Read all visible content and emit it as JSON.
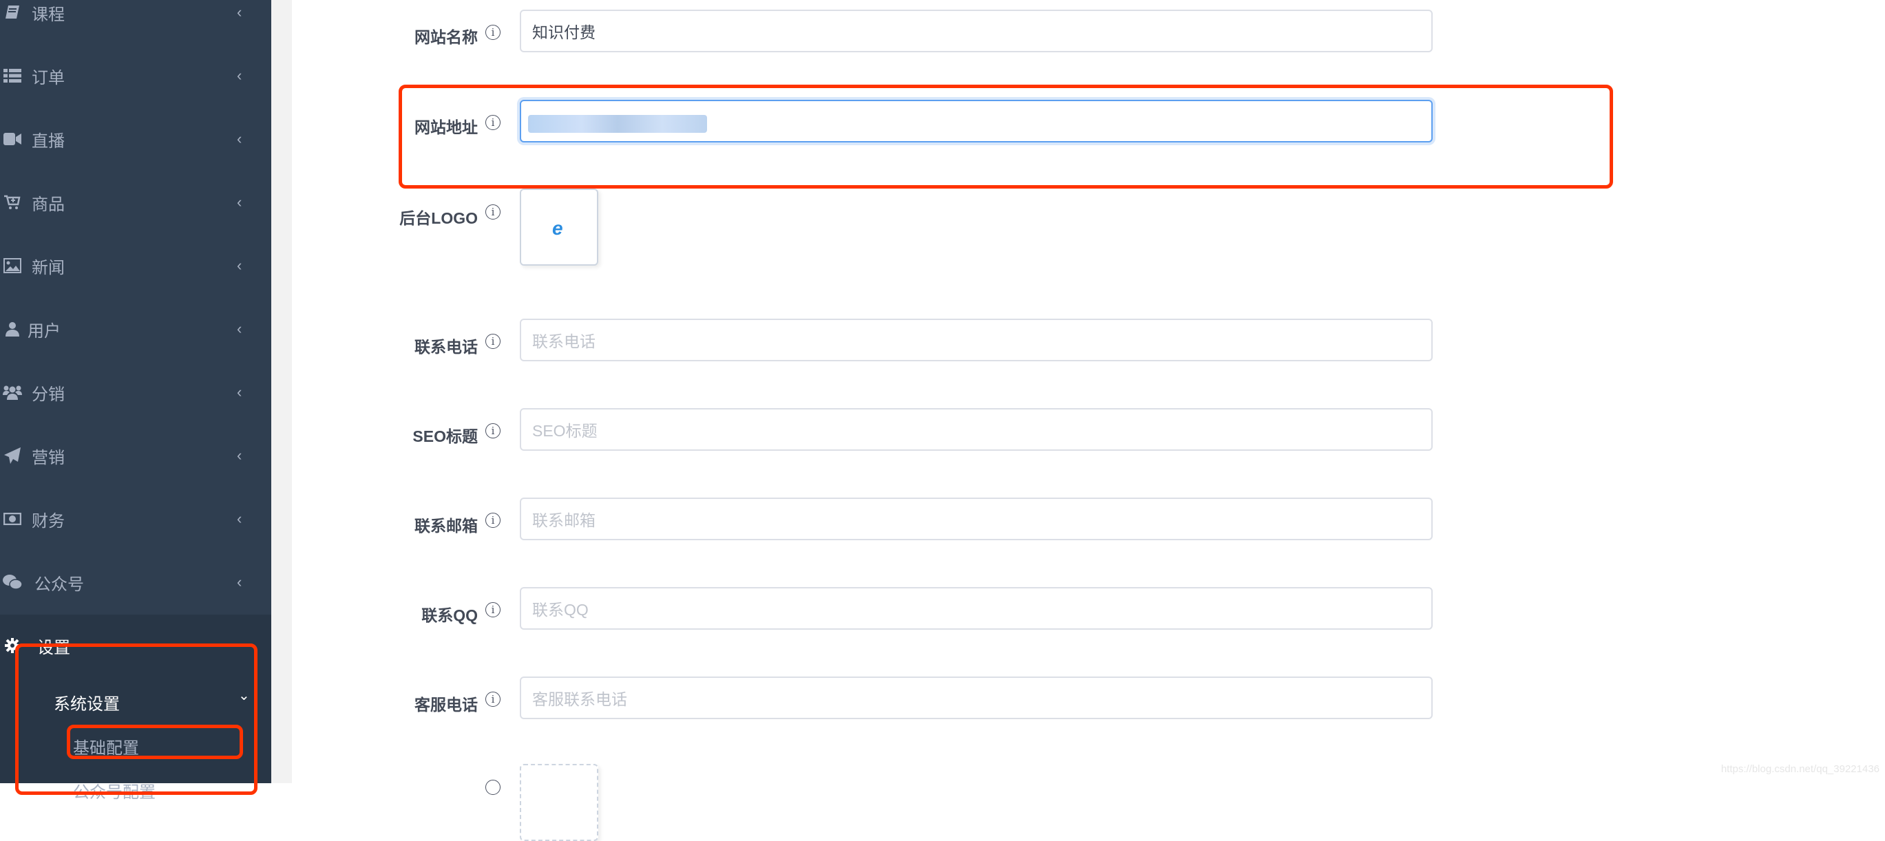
{
  "sidebar": {
    "items": [
      {
        "label": "课程",
        "icon": "book-icon"
      },
      {
        "label": "订单",
        "icon": "list-icon"
      },
      {
        "label": "直播",
        "icon": "video-camera-icon"
      },
      {
        "label": "商品",
        "icon": "cart-plus-icon"
      },
      {
        "label": "新闻",
        "icon": "image-icon"
      },
      {
        "label": "用户",
        "icon": "user-icon"
      },
      {
        "label": "分销",
        "icon": "users-icon"
      },
      {
        "label": "营销",
        "icon": "paper-plane-icon"
      },
      {
        "label": "财务",
        "icon": "money-icon"
      },
      {
        "label": "公众号",
        "icon": "wechat-icon"
      },
      {
        "label": "设置",
        "icon": "gear-icon"
      }
    ],
    "collapsed_chevron": "‹",
    "expanded_chevron": "⌄",
    "submenu": {
      "label": "系统设置",
      "children": [
        "基础配置",
        "公众号配置"
      ]
    }
  },
  "form": {
    "fields": [
      {
        "label": "网站名称",
        "value": "知识付费",
        "placeholder": ""
      },
      {
        "label": "网站地址",
        "value": "",
        "placeholder": "",
        "redacted": true
      },
      {
        "label": "后台LOGO",
        "type": "upload"
      },
      {
        "label": "联系电话",
        "value": "",
        "placeholder": "联系电话"
      },
      {
        "label": "SEO标题",
        "value": "",
        "placeholder": "SEO标题"
      },
      {
        "label": "联系邮箱",
        "value": "",
        "placeholder": "联系邮箱"
      },
      {
        "label": "联系QQ",
        "value": "",
        "placeholder": "联系QQ"
      },
      {
        "label": "客服电话",
        "value": "",
        "placeholder": "客服联系电话"
      }
    ],
    "info_glyph": "i"
  },
  "colors": {
    "sidebar_bg": "#2f3e50",
    "highlight": "#ff3300",
    "focus_border": "#5c9ff0"
  },
  "watermark": "https://blog.csdn.net/qq_39221436"
}
